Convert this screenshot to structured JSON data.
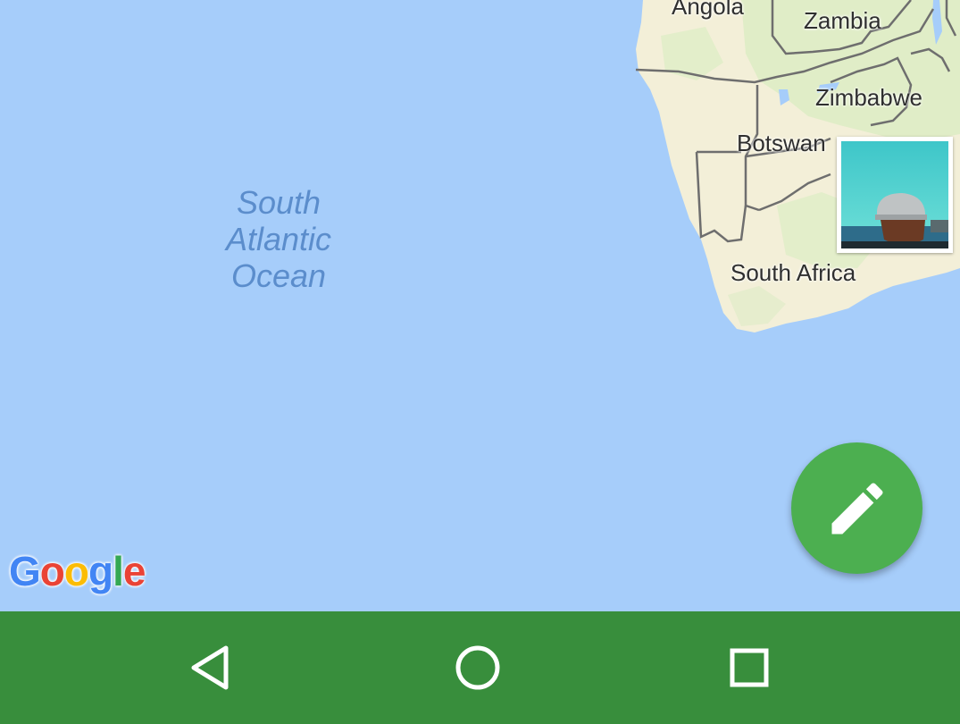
{
  "map": {
    "ocean_label": [
      "South",
      "Atlantic",
      "Ocean"
    ],
    "countries": {
      "angola": "Angola",
      "zambia": "Zambia",
      "zimbabwe": "Zimbabwe",
      "botswana": "Botswan",
      "south_africa": "South Africa"
    },
    "colors": {
      "water": "#a6cdfa",
      "land": "#f3efd8",
      "vegetation": "#d9ecc2",
      "border": "#6e6e6e"
    }
  },
  "attribution": {
    "letters": [
      "G",
      "o",
      "o",
      "g",
      "l",
      "e"
    ],
    "colors": [
      "#4285f4",
      "#ea4335",
      "#fbbc05",
      "#4285f4",
      "#34a853",
      "#ea4335"
    ]
  },
  "fab": {
    "icon": "pencil-icon",
    "color": "#4caf50"
  },
  "navbar": {
    "color": "#388e3c",
    "buttons": [
      "back-icon",
      "home-icon",
      "recents-icon"
    ]
  }
}
